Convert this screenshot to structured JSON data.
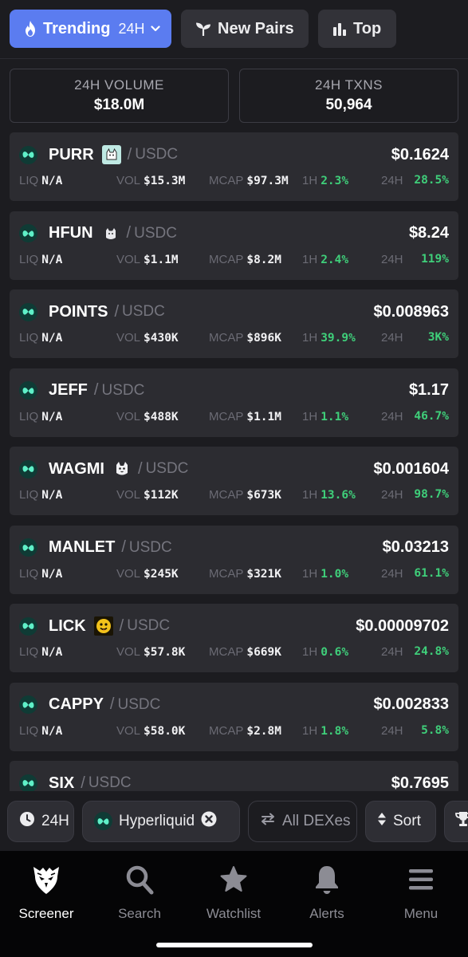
{
  "tabs": {
    "trending_label": "Trending",
    "trending_period": "24H",
    "new_pairs_label": "New Pairs",
    "top_label": "Top"
  },
  "stats": {
    "volume_label": "24H VOLUME",
    "volume_value": "$18.0M",
    "txns_label": "24H TXNS",
    "txns_value": "50,964"
  },
  "labels": {
    "liq": "LIQ",
    "vol": "VOL",
    "mcap": "MCAP",
    "h1": "1H",
    "h24": "24H",
    "slash": "/"
  },
  "pairs": [
    {
      "token": "PURR",
      "logo": "purr-logo",
      "quote": "USDC",
      "price": "$0.1624",
      "liq": "N/A",
      "vol": "$15.3M",
      "mcap": "$97.3M",
      "change_1h": "2.3%",
      "change_24h": "28.5%"
    },
    {
      "token": "HFUN",
      "logo": "hfun-logo",
      "quote": "USDC",
      "price": "$8.24",
      "liq": "N/A",
      "vol": "$1.1M",
      "mcap": "$8.2M",
      "change_1h": "2.4%",
      "change_24h": "119%"
    },
    {
      "token": "POINTS",
      "logo": "",
      "quote": "USDC",
      "price": "$0.008963",
      "liq": "N/A",
      "vol": "$430K",
      "mcap": "$896K",
      "change_1h": "39.9%",
      "change_24h": "3K%"
    },
    {
      "token": "JEFF",
      "logo": "",
      "quote": "USDC",
      "price": "$1.17",
      "liq": "N/A",
      "vol": "$488K",
      "mcap": "$1.1M",
      "change_1h": "1.1%",
      "change_24h": "46.7%"
    },
    {
      "token": "WAGMI",
      "logo": "wagmi-logo",
      "quote": "USDC",
      "price": "$0.001604",
      "liq": "N/A",
      "vol": "$112K",
      "mcap": "$673K",
      "change_1h": "13.6%",
      "change_24h": "98.7%"
    },
    {
      "token": "MANLET",
      "logo": "",
      "quote": "USDC",
      "price": "$0.03213",
      "liq": "N/A",
      "vol": "$245K",
      "mcap": "$321K",
      "change_1h": "1.0%",
      "change_24h": "61.1%"
    },
    {
      "token": "LICK",
      "logo": "lick-logo",
      "quote": "USDC",
      "price": "$0.00009702",
      "liq": "N/A",
      "vol": "$57.8K",
      "mcap": "$669K",
      "change_1h": "0.6%",
      "change_24h": "24.8%"
    },
    {
      "token": "CAPPY",
      "logo": "",
      "quote": "USDC",
      "price": "$0.002833",
      "liq": "N/A",
      "vol": "$58.0K",
      "mcap": "$2.8M",
      "change_1h": "1.8%",
      "change_24h": "5.8%"
    },
    {
      "token": "SIX",
      "logo": "",
      "quote": "USDC",
      "price": "$0.7695",
      "liq": "",
      "vol": "",
      "mcap": "",
      "change_1h": "",
      "change_24h": ""
    }
  ],
  "filters": {
    "timeframe": "24H",
    "chain": "Hyperliquid",
    "dexes": "All DEXes",
    "sort": "Sort"
  },
  "nav": {
    "screener": "Screener",
    "search": "Search",
    "watchlist": "Watchlist",
    "alerts": "Alerts",
    "menu": "Menu"
  },
  "colors": {
    "accent": "#5b7cf0",
    "positive": "#3fcf7a",
    "card": "#2c2c31",
    "background": "#1c1c20",
    "chain_icon": "#5ff0c8"
  }
}
